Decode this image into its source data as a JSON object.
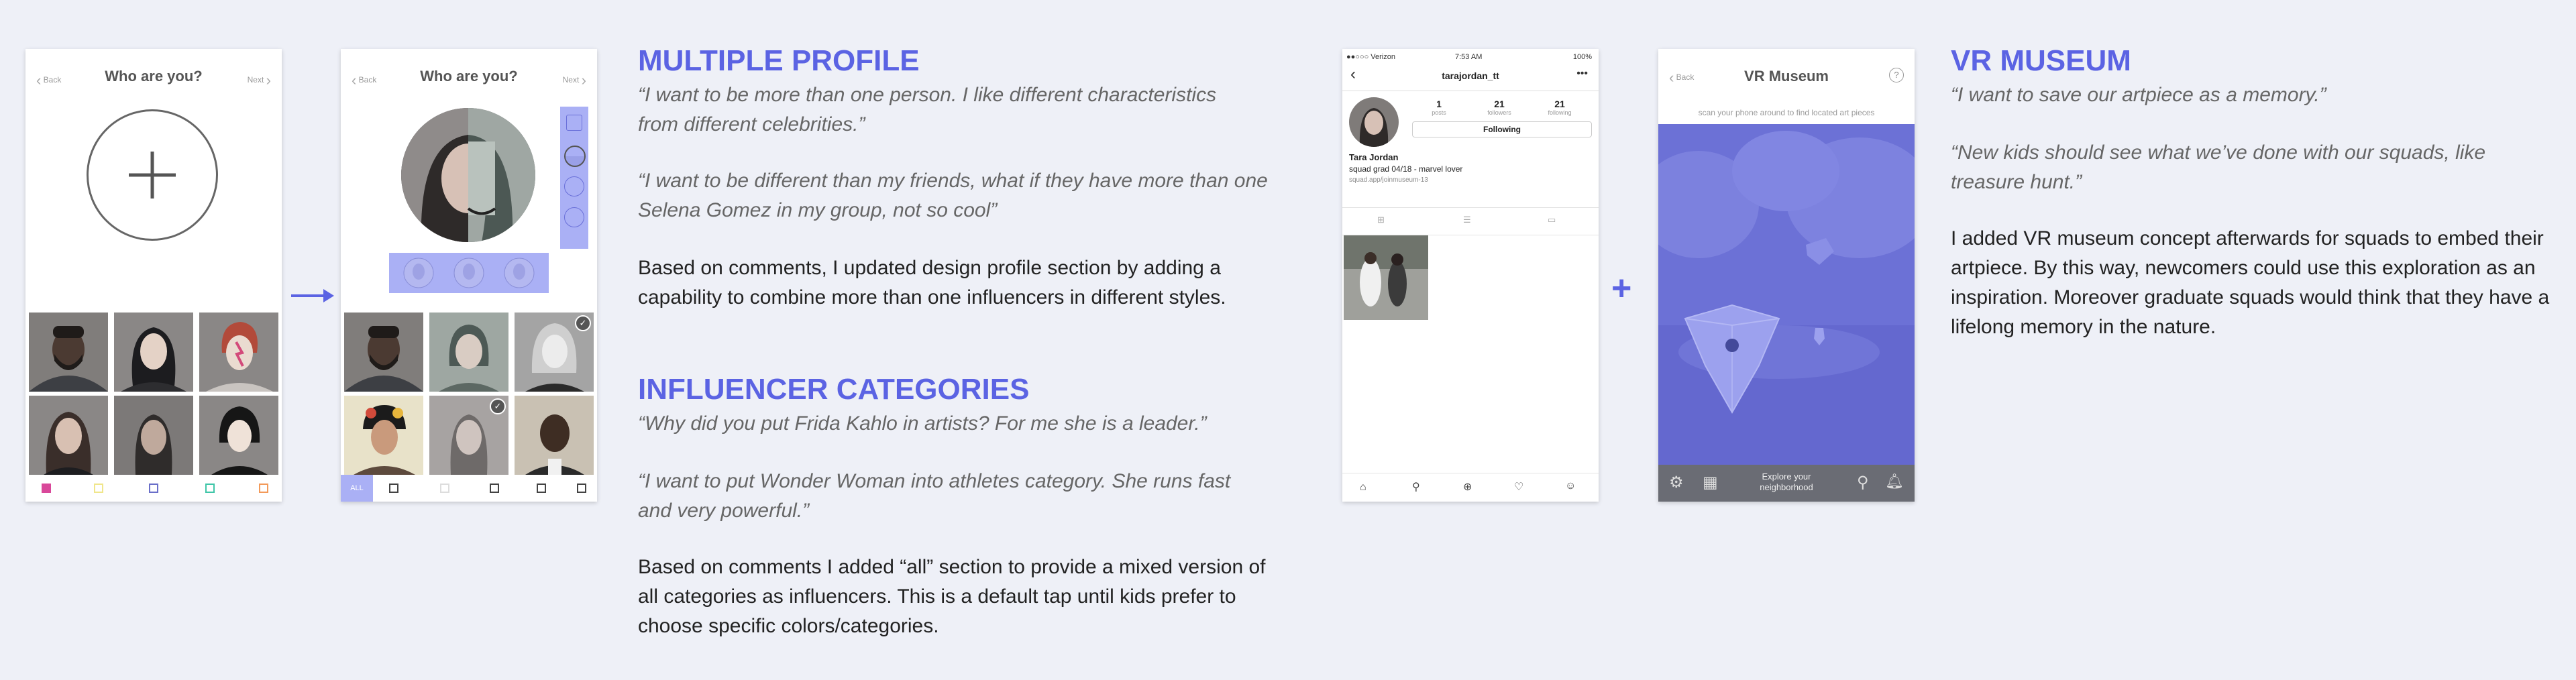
{
  "screen1": {
    "back": "Back",
    "title": "Who are you?",
    "next": "Next",
    "dot_colors": [
      "#d9489a",
      "#f0e68c",
      "#6a6fc9",
      "#3fc6a8",
      "#f39a5a"
    ]
  },
  "screen2": {
    "back": "Back",
    "title": "Who are you?",
    "next": "Next",
    "all_label": "ALL"
  },
  "section1": {
    "heading": "MULTIPLE PROFILE",
    "quote1": "“I want to be more than one person. I like different characteristics from different celebrities.”",
    "quote2": "“I want to be different than my friends, what if they have more than one Selena Gomez in my group, not so cool”",
    "body": "Based on comments, I updated design profile section by adding a capability to combine more than one influencers in different styles."
  },
  "section2": {
    "heading": "INFLUENCER CATEGORIES",
    "quote1": "“Why did you put Frida Kahlo in artists? For me she is a leader.”",
    "quote2": "“I want to put Wonder Woman into athletes category. She runs fast and very powerful.”",
    "body": "Based on comments I added “all” section to provide a mixed version of all categories as influencers. This is a default tap until kids prefer to choose specific colors/categories."
  },
  "insta": {
    "carrier": "●●○○○ Verizon",
    "time": "7:53 AM",
    "battery": "100%",
    "username": "tarajordan_tt",
    "stats": [
      {
        "num": "1",
        "label": "posts"
      },
      {
        "num": "21",
        "label": "followers"
      },
      {
        "num": "21",
        "label": "following"
      }
    ],
    "follow_btn": "Following",
    "name": "Tara Jordan",
    "bio": "squad grad 04/18 - marvel lover",
    "link": "squad.app/joinmuseum-13"
  },
  "plus_sign": "+",
  "vr": {
    "back": "Back",
    "title": "VR Museum",
    "hint": "scan your phone around to find located art pieces",
    "explore": "Explore your neighborhood",
    "help": "?"
  },
  "section3": {
    "heading": "VR MUSEUM",
    "quote1": "“I want to save our artpiece as a memory.”",
    "quote2": "“New kids should see what we’ve done with our squads, like treasure hunt.”",
    "body": "I added VR museum concept afterwards for squads to embed their artpiece. By this way, newcomers could use this exploration as an inspiration. Moreover  graduate squads would think that they have a lifelong memory in the nature."
  },
  "colors": {
    "accent": "#5b63e3",
    "vr_overlay": "#6f74d8",
    "selection": "#aab0f5"
  }
}
